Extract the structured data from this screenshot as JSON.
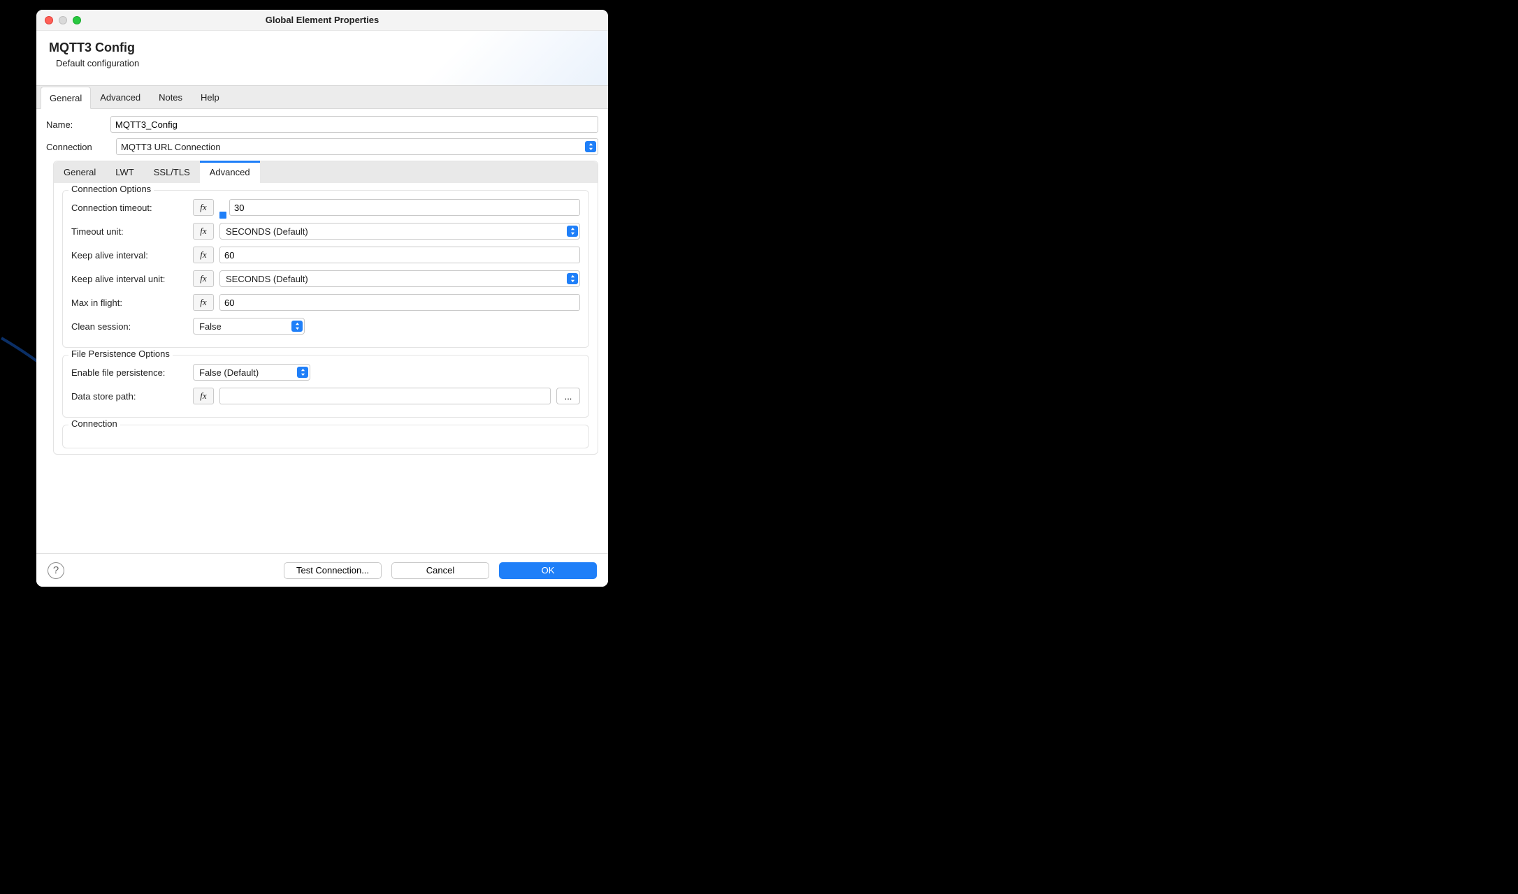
{
  "window": {
    "title": "Global Element Properties"
  },
  "header": {
    "title": "MQTT3 Config",
    "subtitle": "Default configuration"
  },
  "topTabs": {
    "general": "General",
    "advanced": "Advanced",
    "notes": "Notes",
    "help": "Help",
    "active": "General"
  },
  "nameRow": {
    "label": "Name:",
    "value": "MQTT3_Config"
  },
  "connectionRow": {
    "label": "Connection",
    "value": "MQTT3 URL Connection"
  },
  "subTabs": {
    "general": "General",
    "lwt": "LWT",
    "ssltls": "SSL/TLS",
    "advanced": "Advanced",
    "active": "Advanced"
  },
  "connectionOptions": {
    "legend": "Connection Options",
    "connectionTimeout": {
      "label": "Connection timeout:",
      "value": "30"
    },
    "timeoutUnit": {
      "label": "Timeout unit:",
      "value": "SECONDS (Default)"
    },
    "keepAliveInterval": {
      "label": "Keep alive interval:",
      "value": "60"
    },
    "keepAliveIntervalUnit": {
      "label": "Keep alive interval unit:",
      "value": "SECONDS (Default)"
    },
    "maxInFlight": {
      "label": "Max in flight:",
      "value": "60"
    },
    "cleanSession": {
      "label": "Clean session:",
      "value": "False"
    }
  },
  "filePersistence": {
    "legend": "File Persistence Options",
    "enable": {
      "label": "Enable file persistence:",
      "value": "False (Default)"
    },
    "dataStorePath": {
      "label": "Data store path:",
      "value": ""
    }
  },
  "connectionSection": {
    "legend": "Connection"
  },
  "footer": {
    "test": "Test Connection...",
    "cancel": "Cancel",
    "ok": "OK"
  },
  "fx": "fx",
  "ellipsis": "..."
}
